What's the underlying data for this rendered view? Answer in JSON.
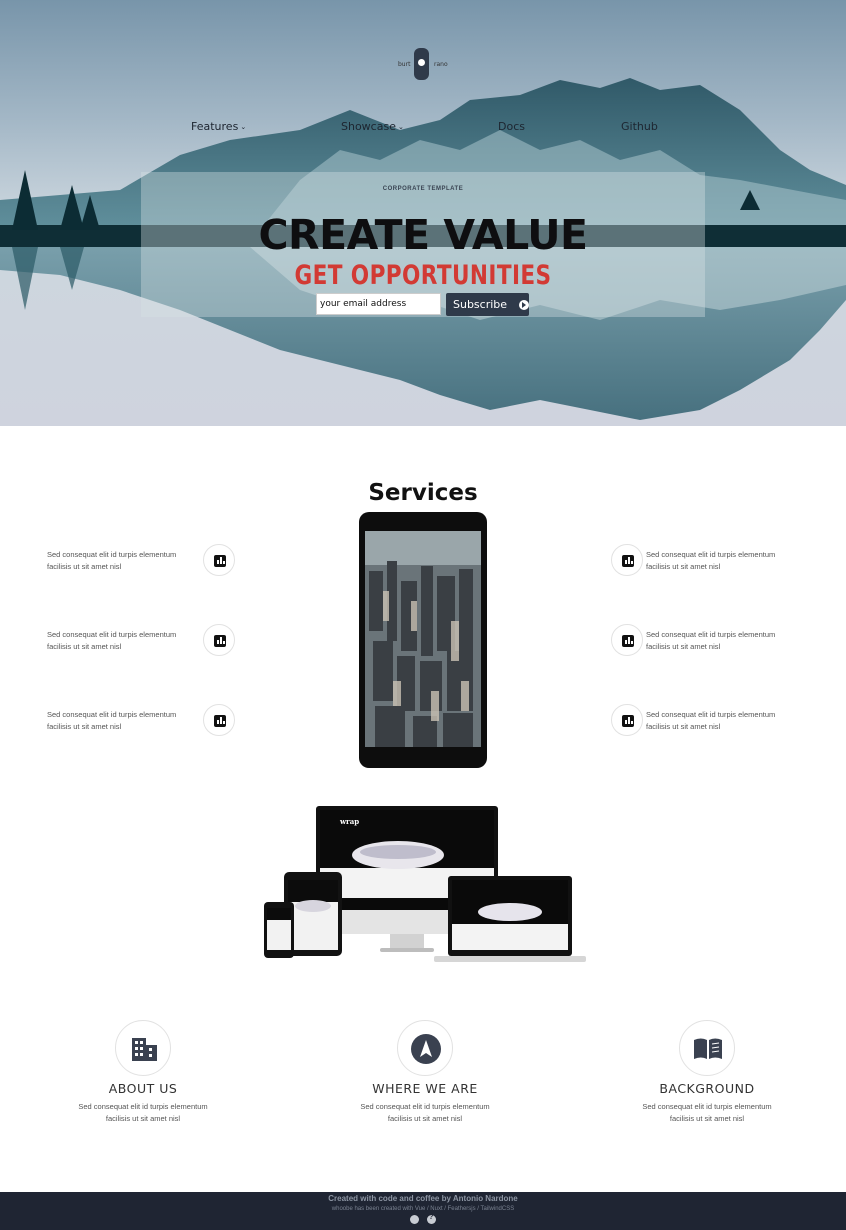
{
  "hero": {
    "toggle": {
      "left_label": "burt",
      "right_label": "rano"
    },
    "nav": [
      {
        "label": "Features",
        "has_dropdown": true
      },
      {
        "label": "Showcase",
        "has_dropdown": true
      },
      {
        "label": "Docs",
        "has_dropdown": false
      },
      {
        "label": "Github",
        "has_dropdown": false
      }
    ],
    "kicker": "CORPORATE TEMPLATE",
    "headline": "CREATE VALUE",
    "subheadline": "GET OPPORTUNITIES",
    "email_placeholder": "your email address",
    "subscribe_label": "Subscribe",
    "colors": {
      "headline": "#0e0e10",
      "subheadline": "#d23a34",
      "button": "#2f3a4a",
      "mountains": "#2e5d6b"
    }
  },
  "services": {
    "title": "Services",
    "features_left": [
      {
        "text": "Sed consequat elit id turpis elementum facilisis ut sit amet nisl",
        "icon": "bar-chart-icon"
      },
      {
        "text": "Sed consequat elit id turpis elementum facilisis ut sit amet nisl",
        "icon": "bar-chart-icon"
      },
      {
        "text": "Sed consequat elit id turpis elementum facilisis ut sit amet nisl",
        "icon": "bar-chart-icon"
      }
    ],
    "features_right": [
      {
        "text": "Sed consequat elit id turpis elementum facilisis ut sit amet nisl",
        "icon": "bar-chart-icon"
      },
      {
        "text": "Sed consequat elit id turpis elementum facilisis ut sit amet nisl",
        "icon": "bar-chart-icon"
      },
      {
        "text": "Sed consequat elit id turpis elementum facilisis ut sit amet nisl",
        "icon": "bar-chart-icon"
      }
    ]
  },
  "devices": {
    "brand": "wrap"
  },
  "info": [
    {
      "title": "ABOUT US",
      "text": "Sed consequat elit id turpis elementum facilisis ut sit amet nisl",
      "icon": "building-icon"
    },
    {
      "title": "WHERE WE ARE",
      "text": "Sed consequat elit id turpis elementum facilisis ut sit amet nisl",
      "icon": "navigation-icon"
    },
    {
      "title": "BACKGROUND",
      "text": "Sed consequat elit id turpis elementum facilisis ut sit amet nisl",
      "icon": "book-icon"
    }
  ],
  "footer": {
    "line1": "Created with code and coffee by Antonio Nardone",
    "line2": "whoobe has been created with Vue / Nuxt / Feathersjs / TailwindCSS",
    "icons": [
      "github-icon",
      "help-icon"
    ],
    "background": "#1f2533"
  }
}
